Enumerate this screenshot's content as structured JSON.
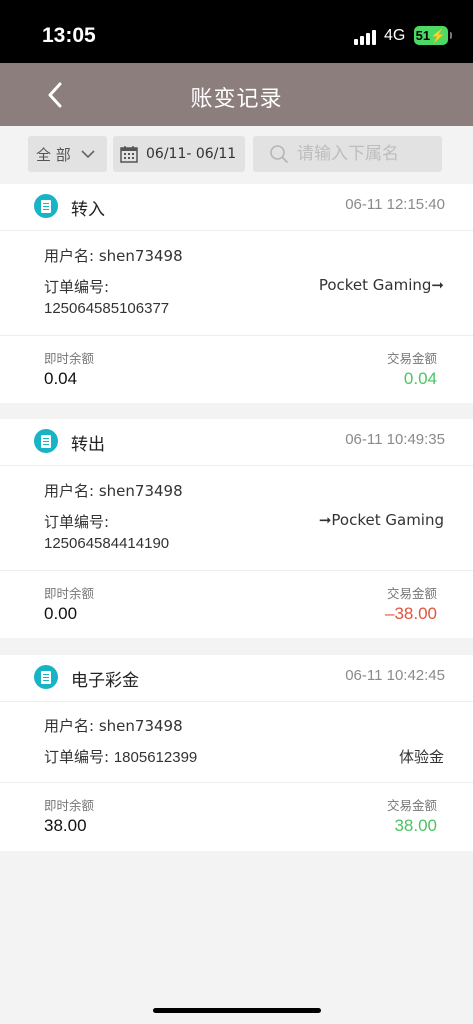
{
  "status": {
    "time": "13:05",
    "network": "4G",
    "battery": "51"
  },
  "nav": {
    "title": "账变记录"
  },
  "filters": {
    "type_label": "全 部",
    "date_range": "06/11- 06/11",
    "search_placeholder": "请输入下属名"
  },
  "records": [
    {
      "type": "转入",
      "time": "06-11 12:15:40",
      "username_label": "用户名:",
      "username": "shen73498",
      "order_label": "订单编号:",
      "order_no": "125064585106377",
      "dest": "Pocket Gaming➞",
      "balance_label": "即时余额",
      "balance": "0.04",
      "amount_label": "交易金额",
      "amount": "0.04",
      "amount_color": "#4cc463"
    },
    {
      "type": "转出",
      "time": "06-11 10:49:35",
      "username_label": "用户名:",
      "username": "shen73498",
      "order_label": "订单编号:",
      "order_no": "125064584414190",
      "dest": "➞Pocket Gaming",
      "balance_label": "即时余额",
      "balance": "0.00",
      "amount_label": "交易金额",
      "amount": "–38.00",
      "amount_color": "#e0553e"
    },
    {
      "type": "电子彩金",
      "time": "06-11 10:42:45",
      "username_label": "用户名:",
      "username": "shen73498",
      "order_label": "订单编号:",
      "order_no": "1805612399",
      "dest": "体验金",
      "balance_label": "即时余额",
      "balance": "38.00",
      "amount_label": "交易金额",
      "amount": "38.00",
      "amount_color": "#4cc463"
    }
  ]
}
